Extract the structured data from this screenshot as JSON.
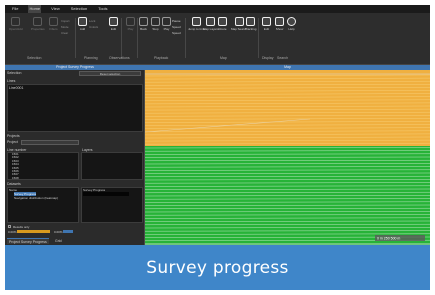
{
  "menu": [
    "File",
    "Home",
    "View",
    "Selection",
    "Tools"
  ],
  "ribbon": {
    "buttons": [
      {
        "label": "Open/Add",
        "icon": "open-icon"
      },
      {
        "label": "Properties",
        "icon": "properties-icon"
      },
      {
        "label": "Filters",
        "icon": "filter-icon"
      },
      {
        "label": "Add",
        "icon": "add-icon"
      },
      {
        "label": "Edit",
        "icon": "edit-icon"
      },
      {
        "label": "Play",
        "icon": "play-icon"
      },
      {
        "label": "Back",
        "icon": "back-icon"
      },
      {
        "label": "Stop",
        "icon": "stop-icon"
      },
      {
        "label": "Play",
        "icon": "play-icon"
      },
      {
        "label": "Jump to time",
        "icon": "clock-icon"
      },
      {
        "label": "Map Layers",
        "icon": "layers-icon"
      },
      {
        "label": "Route",
        "icon": "route-icon"
      },
      {
        "label": "Map Search",
        "icon": "map-search-icon"
      },
      {
        "label": "Tracking",
        "icon": "tracking-icon"
      },
      {
        "label": "Edit",
        "icon": "edit-icon"
      },
      {
        "label": "Show",
        "icon": "search-icon"
      },
      {
        "label": "Help",
        "icon": "help-icon"
      }
    ],
    "small_items": [
      "Import",
      "Mode",
      "Clear",
      "Lock",
      "Unlock",
      "Pause",
      "Speed",
      "Speed"
    ],
    "groups": [
      "Selection",
      "Planning",
      "Observations",
      "Playback",
      "Map",
      "Display",
      "Search"
    ]
  },
  "left": {
    "panel_title": "Project Survey Progress",
    "section_selection": "Selection",
    "button_reset": "Reset selection",
    "section_lines": "Lines",
    "line_selected": "Line0001",
    "section_projects": "Projects",
    "project_label": "Project",
    "section_numbers": "Line number",
    "layers_header": "Layers",
    "line_numbers": [
      "1501",
      "1502",
      "1503",
      "1504",
      "1505",
      "1506",
      "1507",
      "1508"
    ],
    "section_datasets": "Datasets",
    "column_name": "Name",
    "column_progress": "Survey Progress",
    "survey_items": [
      {
        "label": "Survey Progress",
        "selected": true
      },
      {
        "label": "Navigation distribution (heatmap)",
        "selected": false
      }
    ],
    "results_only": "Results only",
    "progress_left_label": "0.00%",
    "progress_right_label": "0.00%",
    "tabs": [
      "Project Survey Progress",
      "Grid"
    ]
  },
  "map": {
    "header": "Map",
    "scale_label": "0 m  250 500 m",
    "colors": {
      "orange": "#f0b040",
      "green": "#27b338",
      "white_lines": "#ffffff"
    }
  },
  "caption": "Survey progress"
}
